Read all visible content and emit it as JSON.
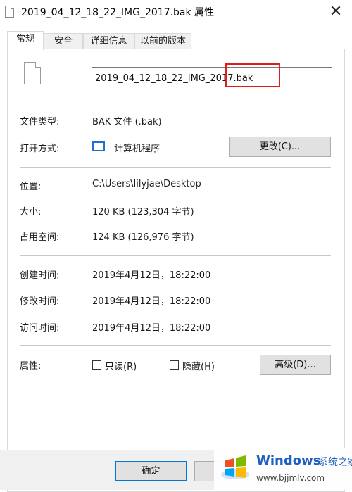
{
  "window": {
    "title": "2019_04_12_18_22_IMG_2017.bak 属性",
    "close_glyph": "✕"
  },
  "tabs": [
    {
      "label": "常规",
      "active": true
    },
    {
      "label": "安全"
    },
    {
      "label": "详细信息"
    },
    {
      "label": "以前的版本"
    }
  ],
  "file_name": "2019_04_12_18_22_IMG_2017.bak",
  "properties": {
    "file_type": {
      "label": "文件类型:",
      "value": "BAK 文件 (.bak)"
    },
    "opens_with": {
      "label": "打开方式:",
      "value": "计算机程序",
      "button": "更改(C)..."
    },
    "location": {
      "label": "位置:",
      "value": "C:\\Users\\lilyjae\\Desktop"
    },
    "size": {
      "label": "大小:",
      "value": "120 KB (123,304 字节)"
    },
    "size_on_disk": {
      "label": "占用空间:",
      "value": "124 KB (126,976 字节)"
    },
    "created": {
      "label": "创建时间:",
      "value": "2019年4月12日，18:22:00"
    },
    "modified": {
      "label": "修改时间:",
      "value": "2019年4月12日，18:22:00"
    },
    "accessed": {
      "label": "访问时间:",
      "value": "2019年4月12日，18:22:00"
    },
    "attributes": {
      "label": "属性:",
      "readonly": "只读(R)",
      "hidden": "隐藏(H)",
      "advanced_button": "高级(D)..."
    }
  },
  "footer": {
    "ok": "确定"
  },
  "watermark": {
    "brand": "Windows",
    "brand2": "系统之家",
    "url": "www.bjjmlv.com"
  },
  "colors": {
    "highlight_border": "#e21b1b",
    "accent": "#0078d7",
    "app_icon": "#1e6fd6"
  },
  "icons": [
    "file-icon",
    "app-window-icon",
    "windows-logo-icon",
    "close-icon"
  ]
}
